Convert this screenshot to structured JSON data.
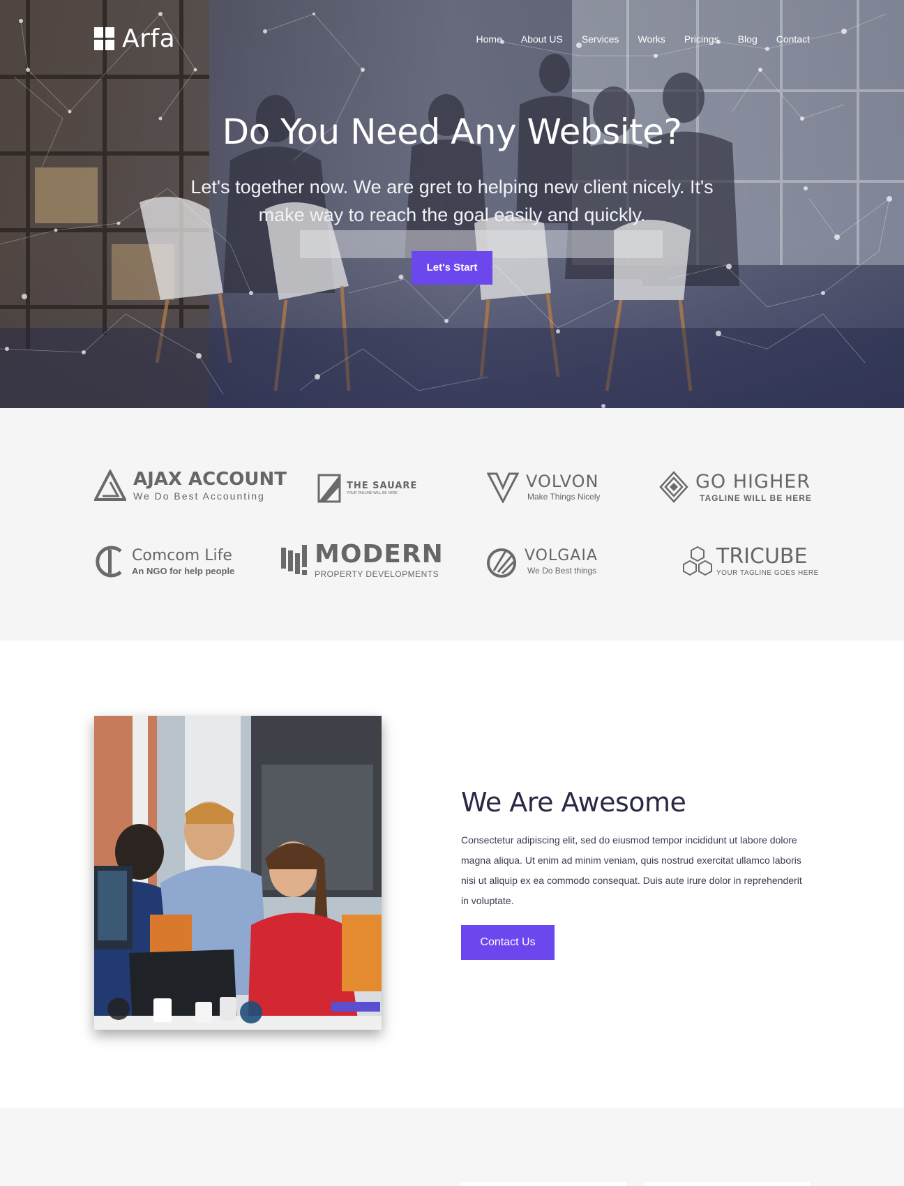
{
  "brand": {
    "name": "Arfa"
  },
  "nav": {
    "items": [
      "Home",
      "About US",
      "Services",
      "Works",
      "Pricings",
      "Blog",
      "Contact"
    ]
  },
  "hero": {
    "title": "Do You Need Any Website?",
    "subtitle": "Let's together now. We are gret to helping new client nicely. It's make way to reach the goal easily and quickly.",
    "cta": "Let's Start"
  },
  "clients": [
    {
      "name": "AJAX ACCOUNT",
      "tagline": "We Do Best Accounting"
    },
    {
      "name": "THE SAUARE",
      "tagline": "YOUR TAGLINE WILL BE HERE"
    },
    {
      "name": "VOLVON",
      "tagline": "Make Things Nicely"
    },
    {
      "name": "GO HIGHER",
      "tagline": "TAGLINE WILL BE HERE"
    },
    {
      "name": "Comcom Life",
      "tagline": "An NGO for help people"
    },
    {
      "name": "MODERN",
      "tagline": "PROPERTY DEVELOPMENTS"
    },
    {
      "name": "VOLGAIA",
      "tagline": "We Do Best things"
    },
    {
      "name": "TRICUBE",
      "tagline": "YOUR TAGLINE GOES HERE"
    }
  ],
  "about": {
    "title": "We Are Awesome",
    "body": "Consectetur adipiscing elit, sed do eiusmod tempor incididunt ut labore dolore magna aliqua. Ut enim ad minim veniam, quis nostrud exercitat ullamco laboris nisi ut aliquip ex ea commodo consequat. Duis aute irure dolor in reprehenderit in voluptate.",
    "cta": "Contact Us"
  },
  "colors": {
    "accent": "#6c47ee",
    "heading": "#2a2945",
    "section_bg": "#f5f5f5"
  }
}
